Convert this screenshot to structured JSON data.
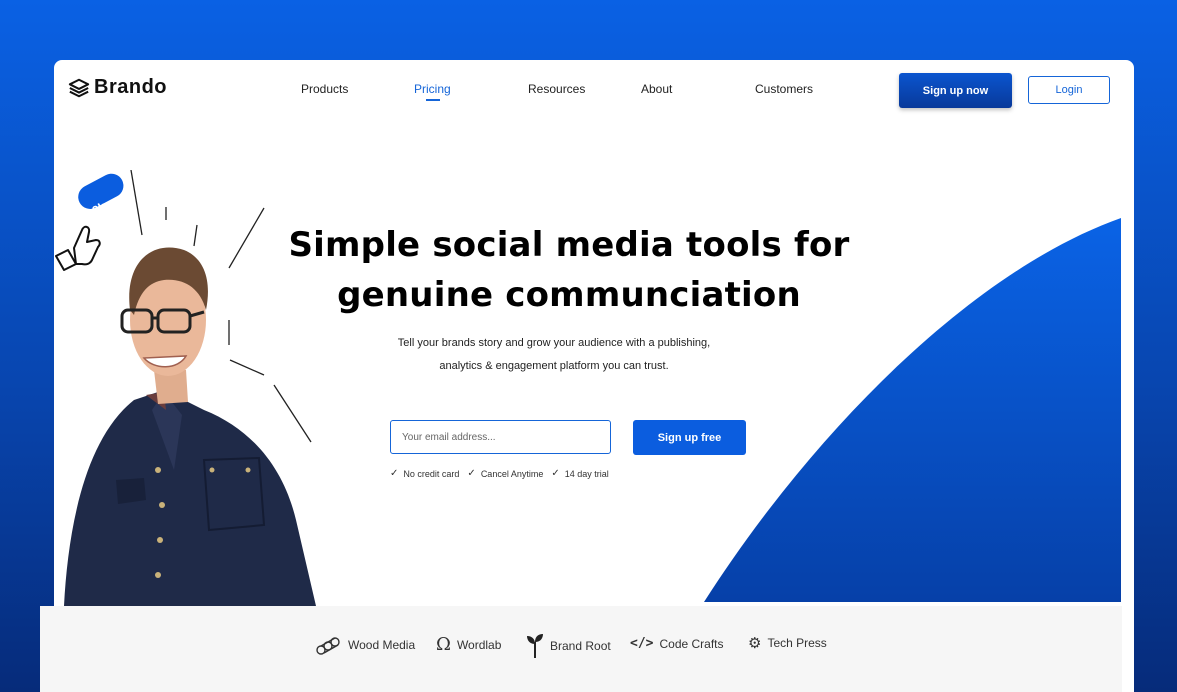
{
  "brand": {
    "name": "Brando",
    "icon": "layers-icon"
  },
  "nav": {
    "items": [
      {
        "label": "Products"
      },
      {
        "label": "Pricing",
        "active": true
      },
      {
        "label": "Resources"
      },
      {
        "label": "About"
      },
      {
        "label": "Customers"
      }
    ],
    "signup_label": "Sign up now",
    "login_label": "Login"
  },
  "hero": {
    "title_line1": "Simple social media tools for",
    "title_line2": "genuine communciation",
    "subtitle_line1": "Tell your brands story and grow your audience with a publishing,",
    "subtitle_line2": "analytics & engagement platform you can trust.",
    "email_placeholder": "Your email address...",
    "cta_label": "Sign up free",
    "checks": [
      "No credit card",
      "Cancel Anytime",
      "14 day trial"
    ],
    "like_badge": "12k"
  },
  "brands": [
    {
      "name": "Wood Media",
      "icon": "logs-icon"
    },
    {
      "name": "Wordlab",
      "icon": "omega-icon"
    },
    {
      "name": "Brand Root",
      "icon": "sprout-icon"
    },
    {
      "name": "Code Crafts",
      "icon": "code-icon"
    },
    {
      "name": "Tech Press",
      "icon": "gears-icon"
    }
  ],
  "colors": {
    "accent": "#1565d8",
    "background": "#0a61e4",
    "dark_accent": "#08399a"
  }
}
